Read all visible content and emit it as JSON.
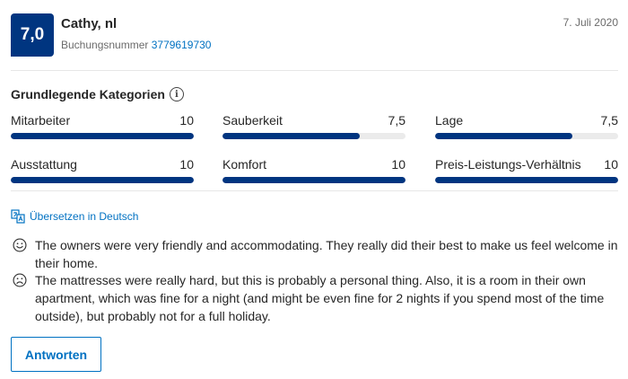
{
  "review": {
    "score": "7,0",
    "reviewer": "Cathy, nl",
    "booking_label": "Buchungsnummer",
    "booking_number": "3779619730",
    "date": "7. Juli 2020"
  },
  "categories": {
    "heading": "Grundlegende Kategorien",
    "info_icon": "i",
    "items": [
      {
        "label": "Mitarbeiter",
        "value": "10",
        "fraction": 1.0
      },
      {
        "label": "Sauberkeit",
        "value": "7,5",
        "fraction": 0.75
      },
      {
        "label": "Lage",
        "value": "7,5",
        "fraction": 0.75
      },
      {
        "label": "Ausstattung",
        "value": "10",
        "fraction": 1.0
      },
      {
        "label": "Komfort",
        "value": "10",
        "fraction": 1.0
      },
      {
        "label": "Preis-Leistungs-Verhältnis",
        "value": "10",
        "fraction": 1.0
      }
    ]
  },
  "translate": {
    "label": "Übersetzen in Deutsch",
    "icon": "translate-icon"
  },
  "comments": {
    "positive": {
      "icon": "smiley-icon",
      "text": "The owners were very friendly and accommodating. They really did their best to make us feel welcome in their home."
    },
    "negative": {
      "icon": "frown-icon",
      "text": "The mattresses were really hard, but this is probably a personal thing. Also, it is a room in their own apartment, which was fine for a night (and might be even fine for 2 nights if you spend most of the time outside), but probably not for a full holiday."
    }
  },
  "actions": {
    "reply_label": "Antworten"
  },
  "colors": {
    "brand": "#003580",
    "link": "#0071c2",
    "bar_bg": "#ebebeb"
  }
}
